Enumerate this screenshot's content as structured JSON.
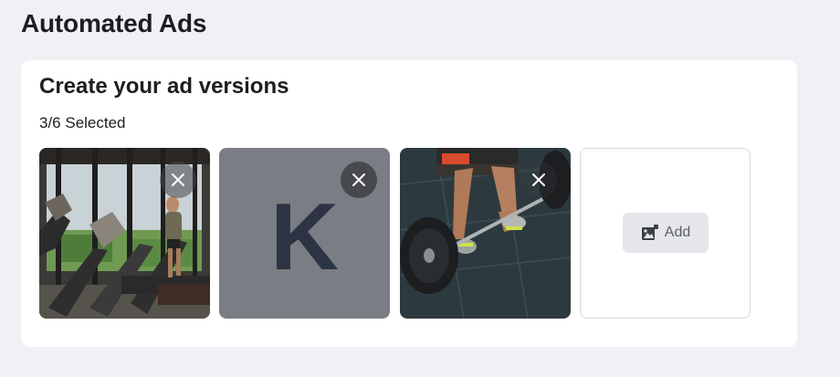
{
  "header": {
    "title": "Automated Ads"
  },
  "card": {
    "title": "Create your ad versions",
    "selected_count": "3/6 Selected"
  },
  "thumbnails": [
    {
      "kind": "photo",
      "subject": "treadmill-gym-photo"
    },
    {
      "kind": "logo",
      "letter": "K"
    },
    {
      "kind": "photo",
      "subject": "barbell-deadlift-photo"
    }
  ],
  "add_tile": {
    "label": "Add",
    "icon": "add-image-icon"
  },
  "icons": {
    "remove": "close-icon"
  },
  "colors": {
    "background": "#f0f1f5",
    "card": "#ffffff",
    "logo_tile": "#7b7d84",
    "logo_letter": "#2c3444",
    "add_button": "#e4e6eb"
  }
}
